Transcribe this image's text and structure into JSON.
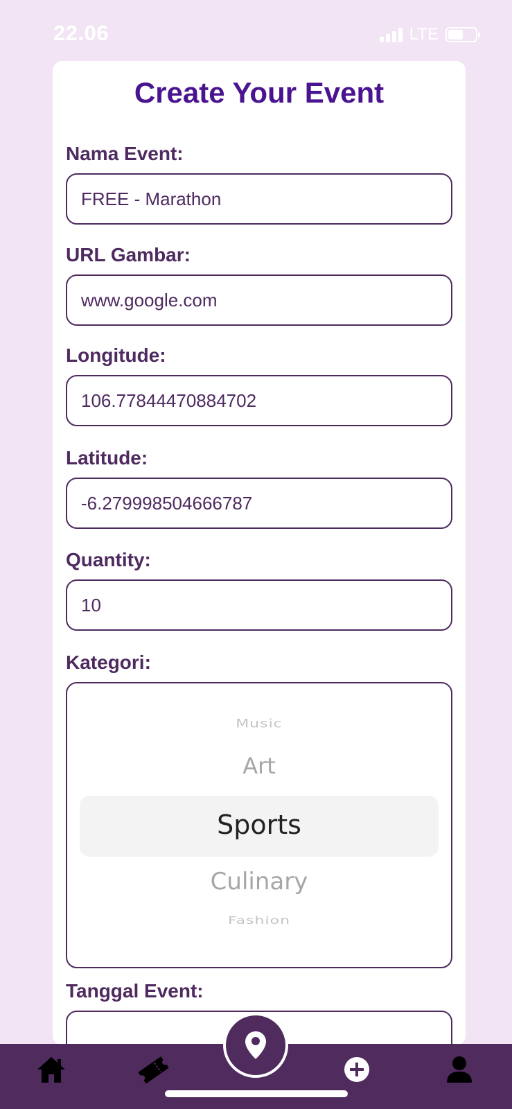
{
  "status_bar": {
    "time": "22.06",
    "network": "LTE"
  },
  "form": {
    "title": "Create Your Event",
    "fields": [
      {
        "label": "Nama Event:",
        "value": "FREE - Marathon"
      },
      {
        "label": "URL Gambar:",
        "value": "www.google.com"
      },
      {
        "label": "Longitude:",
        "value": "106.77844470884702"
      },
      {
        "label": "Latitude:",
        "value": "-6.279998504666787"
      },
      {
        "label": "Quantity:",
        "value": "10"
      }
    ],
    "category": {
      "label": "Kategori:",
      "options": [
        "Music",
        "Art",
        "Sports",
        "Culinary",
        "Fashion"
      ],
      "selected": "Sports"
    },
    "date": {
      "label": "Tanggal Event:"
    }
  },
  "tab_bar": {
    "items": [
      {
        "name": "home",
        "icon": "home-icon"
      },
      {
        "name": "tickets",
        "icon": "ticket-icon"
      },
      {
        "name": "map",
        "icon": "map-pin-icon"
      },
      {
        "name": "create",
        "icon": "plus-circle-icon"
      },
      {
        "name": "profile",
        "icon": "person-icon"
      }
    ]
  },
  "colors": {
    "background": "#f2e4f5",
    "title": "#4a1490",
    "label": "#4e2a5f",
    "tab_bar": "#4f2b5e"
  }
}
